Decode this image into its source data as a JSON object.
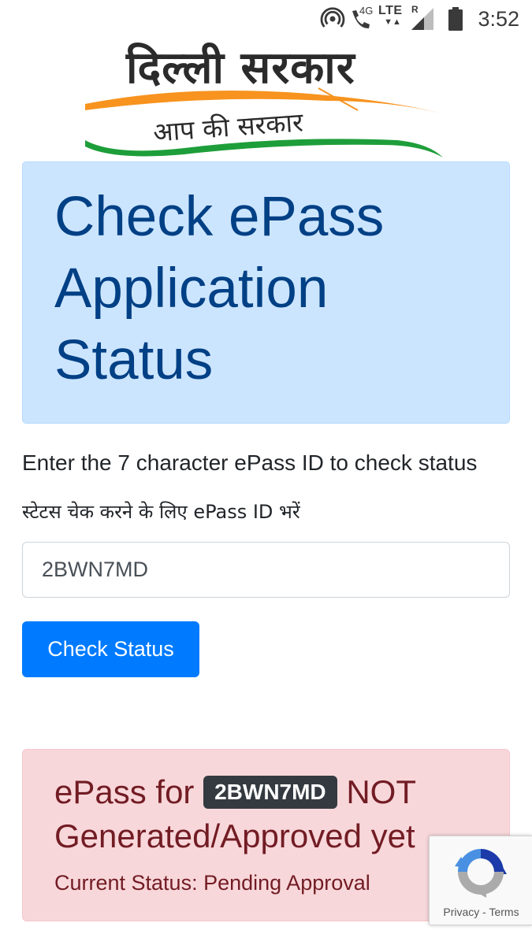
{
  "status_bar": {
    "network_4g": "4G",
    "lte": "LTE",
    "roaming": "R",
    "time": "3:52",
    "icons": [
      "hotspot-icon",
      "wifi-calling-icon",
      "lte-data-arrows-icon",
      "signal-icon",
      "battery-icon"
    ]
  },
  "logo": {
    "title": "दिल्ली सरकार",
    "tagline": "आप की सरकार"
  },
  "header": {
    "title": "Check ePass Application Status"
  },
  "form": {
    "instruction_en": "Enter the 7 character ePass ID to check status",
    "instruction_hi": "स्टेटस चेक करने के लिए ePass ID भरें",
    "epass_id_value": "2BWN7MD",
    "check_button_label": "Check Status"
  },
  "result": {
    "prefix": "ePass for",
    "epass_id": "2BWN7MD",
    "suffix": "NOT Generated/Approved yet",
    "status_text": "Current Status: Pending Approval"
  },
  "recaptcha": {
    "links": "Privacy - Terms"
  },
  "colors": {
    "header_bg": "#cce5ff",
    "header_text": "#004085",
    "button_bg": "#007bff",
    "alert_bg": "#f8d7da",
    "alert_text": "#721c24",
    "badge_bg": "#343a40",
    "saffron": "#f7931e",
    "green": "#1e9e3a"
  }
}
